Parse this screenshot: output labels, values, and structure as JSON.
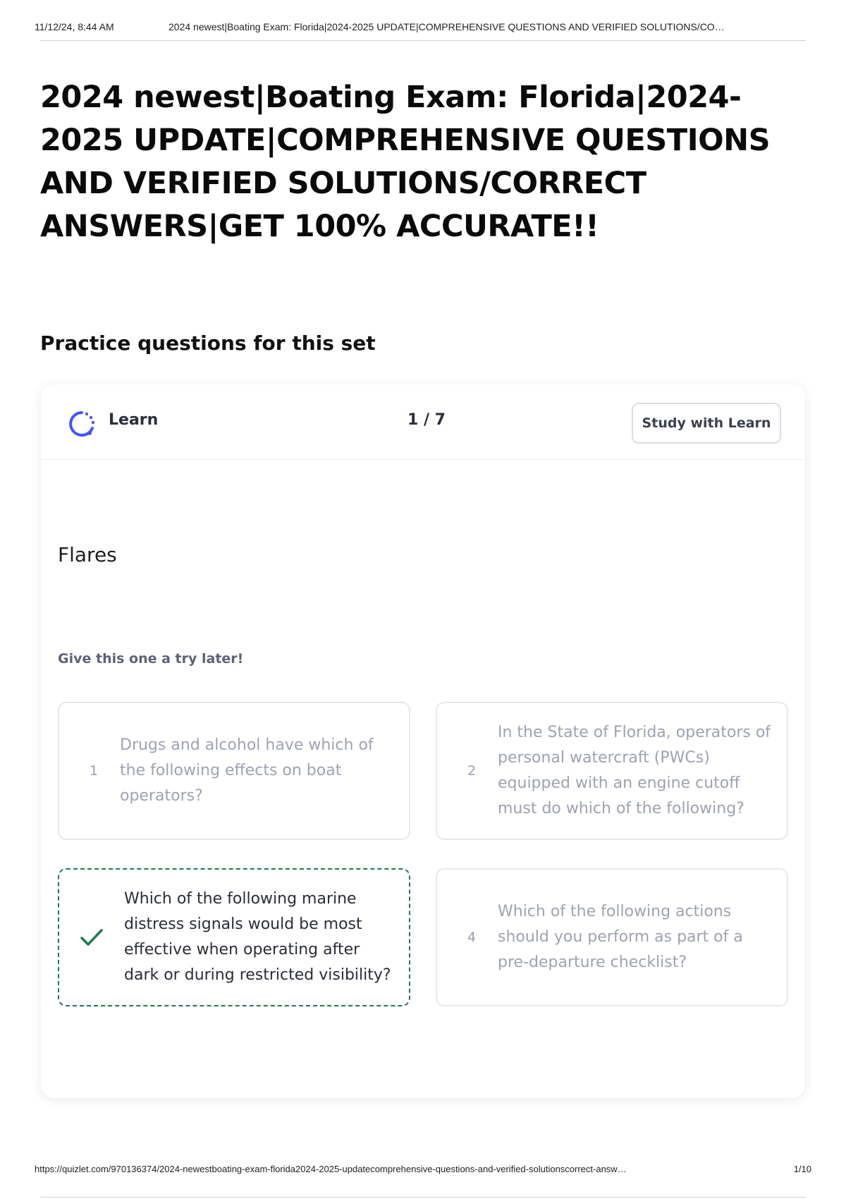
{
  "print_header": {
    "datetime": "11/12/24, 8:44 AM",
    "title": "2024 newest|Boating Exam: Florida|2024-2025 UPDATE|COMPREHENSIVE QUESTIONS AND VERIFIED SOLUTIONS/CO…"
  },
  "page": {
    "title": "2024 newest|Boating Exam: Florida|2024-2025 UPDATE|COMPREHENSIVE QUESTIONS AND VERIFIED SOLUTIONS/CORRECT ANSWERS|GET 100% ACCURATE!!",
    "section_heading": "Practice questions for this set"
  },
  "learn_card": {
    "mode_label": "Learn",
    "mode_icon": "learn-progress-icon",
    "progress": "1 / 7",
    "study_button_label": "Study with Learn",
    "term": "Flares",
    "hint": "Give this one a try later!",
    "options": [
      {
        "number": "1",
        "text": "Drugs and alcohol have which of the following effects on boat operators?",
        "selected": false
      },
      {
        "number": "2",
        "text": "In the State of Florida, operators of personal watercraft (PWCs) equipped with an engine cutoff must do which of the following?",
        "selected": false
      },
      {
        "number": "",
        "text": "Which of the following marine distress signals would be most effective when operating after dark or during restricted visibility?",
        "selected": true,
        "icon": "check-icon"
      },
      {
        "number": "4",
        "text": "Which of the following actions should you perform as part of a pre-departure checklist?",
        "selected": false
      }
    ],
    "colors": {
      "accent": "#4255ff",
      "correct": "#1f7a4d",
      "muted_text": "#9ea2b3"
    }
  },
  "print_footer": {
    "url": "https://quizlet.com/970136374/2024-newestboating-exam-florida2024-2025-updatecomprehensive-questions-and-verified-solutionscorrect-answ…",
    "page": "1/10"
  }
}
